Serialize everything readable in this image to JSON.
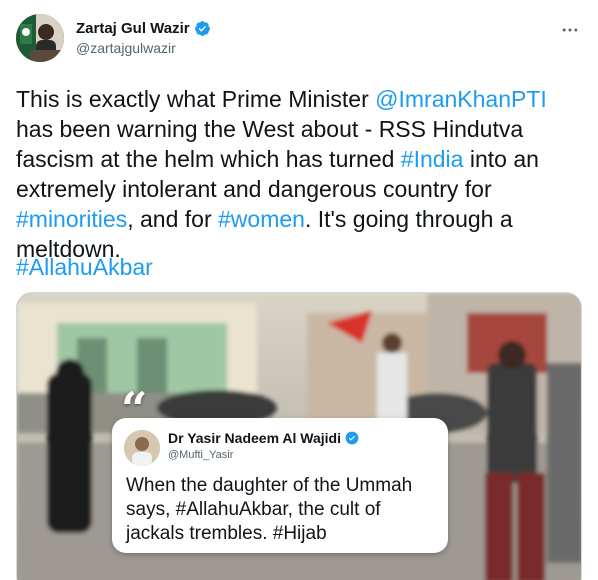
{
  "author": {
    "name": "Zartaj Gul Wazir",
    "handle": "@zartajgulwazir"
  },
  "tweet": {
    "segments": [
      {
        "text": "This is exactly what Prime Minister ",
        "type": "text"
      },
      {
        "text": "@ImranKhanPTI",
        "type": "link"
      },
      {
        "text": " has been warning the West about - RSS Hindutva fascism at the helm which has turned ",
        "type": "text"
      },
      {
        "text": "#India",
        "type": "link"
      },
      {
        "text": " into an extremely intolerant and dangerous country for ",
        "type": "text"
      },
      {
        "text": "#minorities",
        "type": "link"
      },
      {
        "text": ", and for ",
        "type": "text"
      },
      {
        "text": "#women",
        "type": "link"
      },
      {
        "text": ". It's going through a meltdown.",
        "type": "text"
      }
    ],
    "hashtag_line": "#AllahuAkbar"
  },
  "media": {
    "quote": {
      "name": "Dr Yasir Nadeem Al Wajidi",
      "handle": "@Mufti_Yasir",
      "text": "When the daughter of the Ummah says, #AllahuAkbar, the cult of jackals trembles. #Hijab"
    }
  },
  "colors": {
    "link": "#1d9bf0",
    "text": "#0f1419",
    "secondary": "#536471",
    "verified": "#1d9bf0"
  },
  "icons": {
    "more": "more-horizontal-icon",
    "verified": "verified-badge-icon",
    "quote": "quote-mark-icon"
  }
}
